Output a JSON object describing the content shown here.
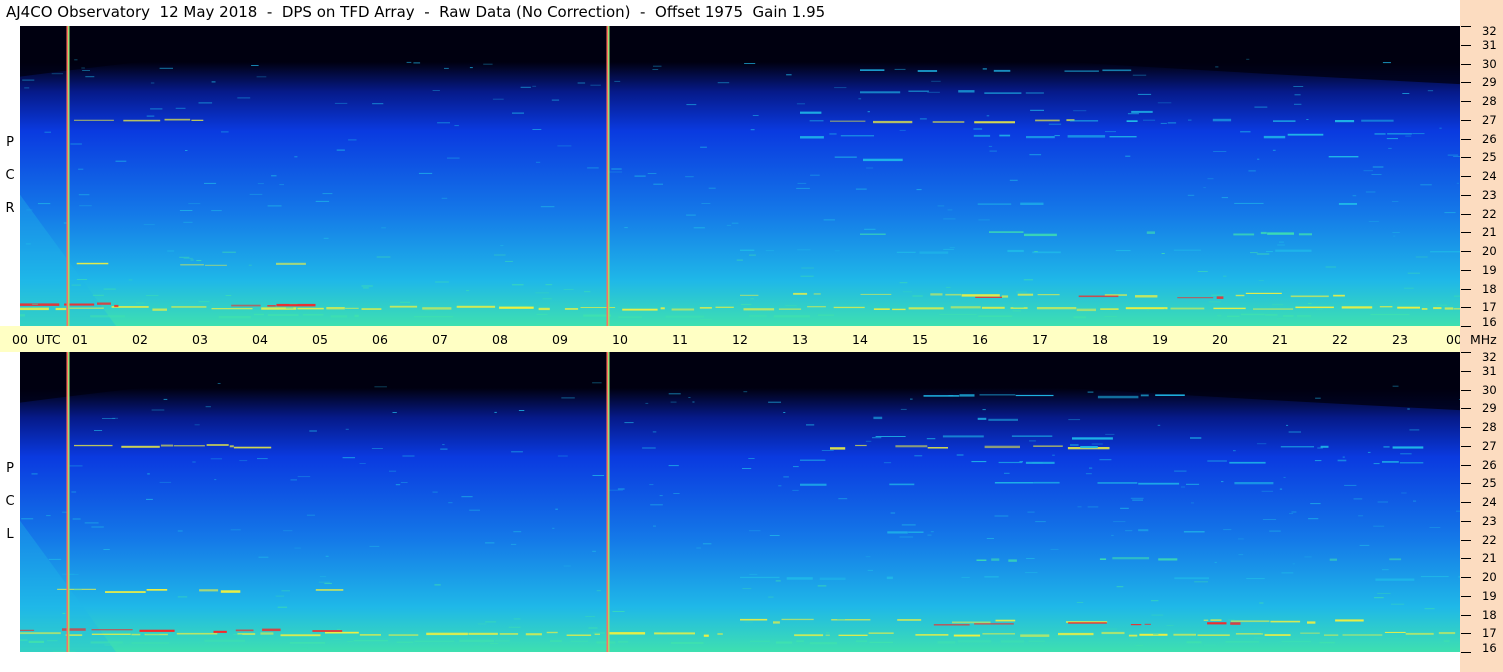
{
  "title": "AJ4CO Observatory  12 May 2018  -  DPS on TFD Array  -  Raw Data (No Correction)  -  Offset 1975  Gain 1.95",
  "panels": [
    {
      "id": "rcp",
      "label_letters": [
        "P",
        "C",
        "R"
      ]
    },
    {
      "id": "lcp",
      "label_letters": [
        "P",
        "C",
        "L"
      ]
    }
  ],
  "colors": {
    "background_upper": "#000010",
    "band_blue": "#0a3ae0",
    "mid_cyan": "#1fb8e8",
    "low_green": "#3ee0b0",
    "hot_yellow": "#f0f040",
    "hot_red": "#ff2020",
    "time_axis_bg": "#ffffc4",
    "freq_axis_bg": "#fcdcc0"
  },
  "chart_data": {
    "type": "heatmap",
    "title": "AJ4CO Observatory  12 May 2018  -  DPS on TFD Array  -  Raw Data (No Correction)  -  Offset 1975  Gain 1.95",
    "x_tick_labels": [
      "00  UTC",
      "01",
      "02",
      "03",
      "04",
      "05",
      "06",
      "07",
      "08",
      "09",
      "10",
      "11",
      "12",
      "13",
      "14",
      "15",
      "16",
      "17",
      "18",
      "19",
      "20",
      "21",
      "22",
      "23",
      "00"
    ],
    "x_unit_label": "MHz",
    "x_range_hours": [
      0,
      24
    ],
    "y_tick_labels": [
      "32",
      "31",
      "30",
      "29",
      "28",
      "27",
      "26",
      "25",
      "24",
      "23",
      "22",
      "21",
      "20",
      "19",
      "18",
      "17",
      "16"
    ],
    "y_range_mhz": [
      16,
      32
    ],
    "panels": [
      "RCP",
      "LCP"
    ],
    "interference_lines_utc": [
      0.8,
      9.8
    ],
    "persistent_bands_mhz": [
      17.0,
      17.7,
      27.0,
      29.7,
      21.0,
      25.0
    ]
  }
}
